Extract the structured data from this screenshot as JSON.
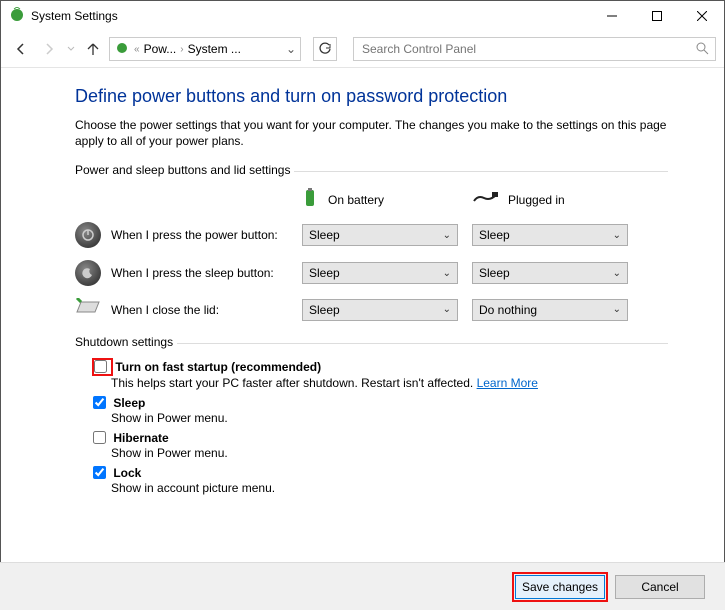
{
  "window": {
    "title": "System Settings"
  },
  "toolbar": {
    "breadcrumb": {
      "p1": "Pow...",
      "p2": "System ..."
    },
    "search_placeholder": "Search Control Panel"
  },
  "page": {
    "heading": "Define power buttons and turn on password protection",
    "description": "Choose the power settings that you want for your computer. The changes you make to the settings on this page apply to all of your power plans."
  },
  "group_power": {
    "legend": "Power and sleep buttons and lid settings",
    "col_battery": "On battery",
    "col_plugged": "Plugged in",
    "rows": [
      {
        "label": "When I press the power button:",
        "battery": "Sleep",
        "plugged": "Sleep"
      },
      {
        "label": "When I press the sleep button:",
        "battery": "Sleep",
        "plugged": "Sleep"
      },
      {
        "label": "When I close the lid:",
        "battery": "Sleep",
        "plugged": "Do nothing"
      }
    ]
  },
  "group_shutdown": {
    "legend": "Shutdown settings",
    "fast": {
      "label": "Turn on fast startup (recommended)",
      "desc": "This helps start your PC faster after shutdown. Restart isn't affected. ",
      "learn_more": "Learn More"
    },
    "sleep": {
      "label": "Sleep",
      "desc": "Show in Power menu."
    },
    "hibernate": {
      "label": "Hibernate",
      "desc": "Show in Power menu."
    },
    "lock": {
      "label": "Lock",
      "desc": "Show in account picture menu."
    }
  },
  "footer": {
    "save": "Save changes",
    "cancel": "Cancel"
  }
}
